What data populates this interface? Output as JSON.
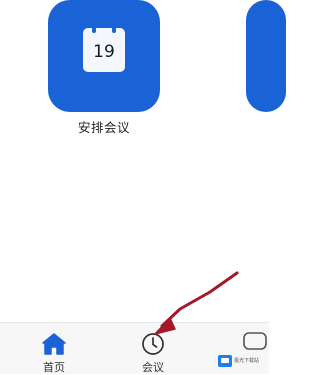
{
  "tiles": {
    "schedule": {
      "label": "安排会议",
      "calendar_day": "19"
    }
  },
  "tabbar": {
    "home_label": "首页",
    "meetings_label": "会议"
  },
  "colors": {
    "accent": "#1a63d6",
    "arrow": "#a3192b"
  },
  "watermark": {
    "text": "极光下载站"
  },
  "icons": {
    "schedule": "calendar-icon",
    "home": "home-icon",
    "meetings": "clock-icon",
    "arrow": "arrow-annotation"
  }
}
